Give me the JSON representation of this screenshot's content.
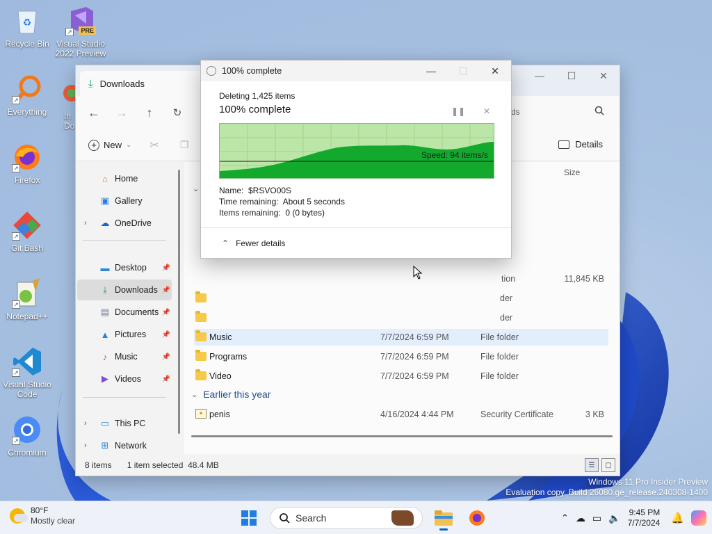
{
  "desktop": {
    "icons": [
      {
        "label_1": "Recycle Bin",
        "label_2": ""
      },
      {
        "label_1": "Visual Studio",
        "label_2": "2022 Preview",
        "badge": "PRE"
      },
      {
        "label_1": "Everything",
        "label_2": ""
      },
      {
        "label_1": "Firefox",
        "label_2": ""
      },
      {
        "label_1": "Git Bash",
        "label_2": ""
      },
      {
        "label_1": "Notepad++",
        "label_2": ""
      },
      {
        "label_1": "Visual Studio",
        "label_2": "Code"
      },
      {
        "label_1": "Chromium",
        "label_2": ""
      },
      {
        "label_1": "In",
        "label_2": "Do"
      }
    ]
  },
  "explorer": {
    "tab_title": "Downloads",
    "address_fragment": "ds",
    "toolbar": {
      "new_label": "New",
      "details_label": "Details"
    },
    "sidebar": {
      "items": [
        {
          "label": "Home",
          "icon": "home-icon"
        },
        {
          "label": "Gallery",
          "icon": "gallery-icon"
        },
        {
          "label": "OneDrive",
          "icon": "cloud-icon"
        },
        {
          "label": "Desktop",
          "icon": "desktop-icon"
        },
        {
          "label": "Downloads",
          "icon": "download-icon"
        },
        {
          "label": "Documents",
          "icon": "document-icon"
        },
        {
          "label": "Pictures",
          "icon": "picture-icon"
        },
        {
          "label": "Music",
          "icon": "music-icon"
        },
        {
          "label": "Videos",
          "icon": "video-icon"
        },
        {
          "label": "This PC",
          "icon": "pc-icon"
        },
        {
          "label": "Network",
          "icon": "network-icon"
        }
      ]
    },
    "columns": {
      "size": "Size"
    },
    "partial_rows": [
      {
        "type_frag": "tion",
        "size": "11,845 KB"
      },
      {
        "type_frag": "der",
        "size": ""
      },
      {
        "type_frag": "der",
        "size": ""
      }
    ],
    "rows": [
      {
        "name": "Music",
        "date": "7/7/2024 6:59 PM",
        "type": "File folder",
        "size": ""
      },
      {
        "name": "Programs",
        "date": "7/7/2024 6:59 PM",
        "type": "File folder",
        "size": ""
      },
      {
        "name": "Video",
        "date": "7/7/2024 6:59 PM",
        "type": "File folder",
        "size": ""
      }
    ],
    "group_earlier": "Earlier this year",
    "earlier_rows": [
      {
        "name": "penis",
        "date": "4/16/2024 4:44 PM",
        "type": "Security Certificate",
        "size": "3 KB"
      }
    ],
    "status": {
      "items": "8 items",
      "selected": "1 item selected  48.4 MB"
    }
  },
  "dialog": {
    "title": "100% complete",
    "deleting": "Deleting 1,425 items",
    "heading": "100% complete",
    "speed": "Speed: 94 items/s",
    "name": "Name:  $RSVO00S",
    "time_remaining": "Time remaining:  About 5 seconds",
    "items_remaining": "Items remaining:  0 (0 bytes)",
    "fewer_details": "Fewer details",
    "progress_percent": 100
  },
  "taskbar": {
    "weather_temp": "80°F",
    "weather_desc": "Mostly clear",
    "search_placeholder": "Search",
    "time": "9:45 PM",
    "date": "7/7/2024"
  },
  "watermark": {
    "line1": "Windows 11 Pro Insider Preview",
    "line2": "Evaluation copy. Build 26080.ge_release.240308-1400"
  }
}
